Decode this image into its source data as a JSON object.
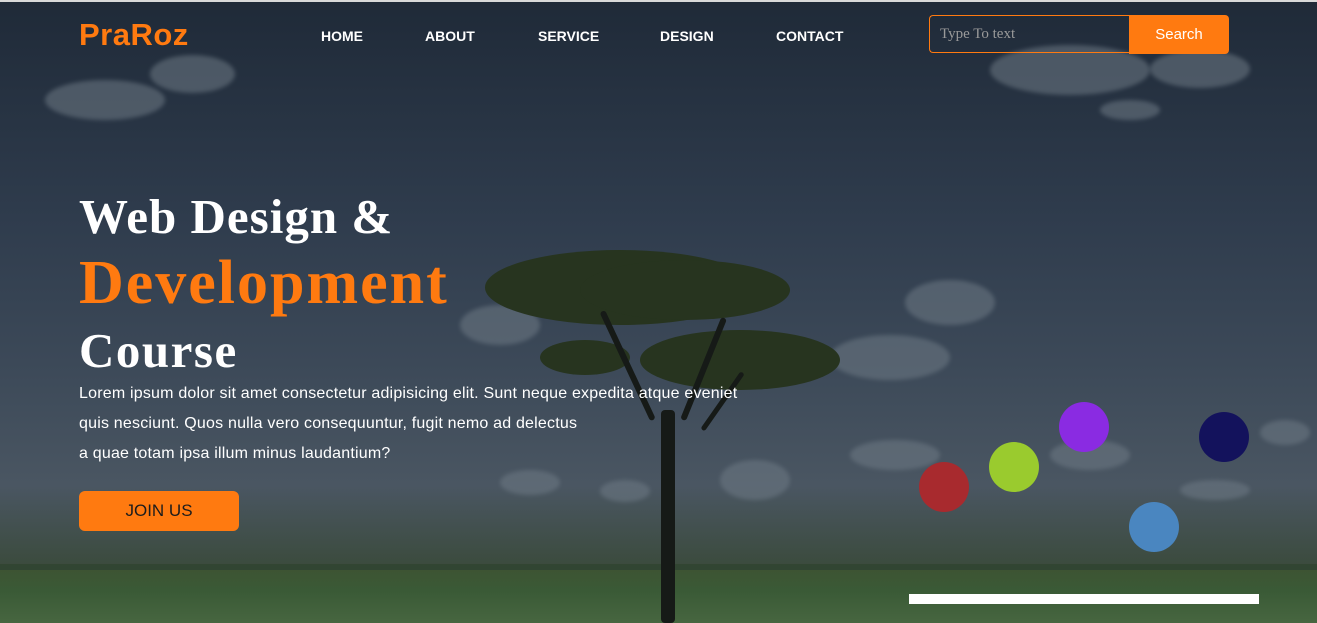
{
  "brand": {
    "logo": "PraRoz",
    "accent_color": "#ff7a10"
  },
  "nav": {
    "items": [
      {
        "label": "HOME"
      },
      {
        "label": "ABOUT"
      },
      {
        "label": "SERVICE"
      },
      {
        "label": "DESIGN"
      },
      {
        "label": "CONTACT"
      }
    ]
  },
  "search": {
    "placeholder": "Type To text",
    "button_label": "Search"
  },
  "hero": {
    "title_line1": "Web Design &",
    "title_line2": "Development",
    "title_line3": "Course",
    "paragraph_lines": [
      "Lorem ipsum dolor sit amet consectetur adipisicing elit. Sunt neque expedita atque eveniet",
      "quis nesciunt. Quos nulla vero consequuntur, fugit nemo ad delectus",
      "a quae totam ipsa illum minus laudantium?"
    ],
    "cta_label": "JOIN US"
  },
  "decor": {
    "dot_colors": [
      "#a82a2e",
      "#9acb2e",
      "#8a2be2",
      "#4a86c0",
      "#13125c"
    ],
    "bar_color": "#ffffff"
  }
}
